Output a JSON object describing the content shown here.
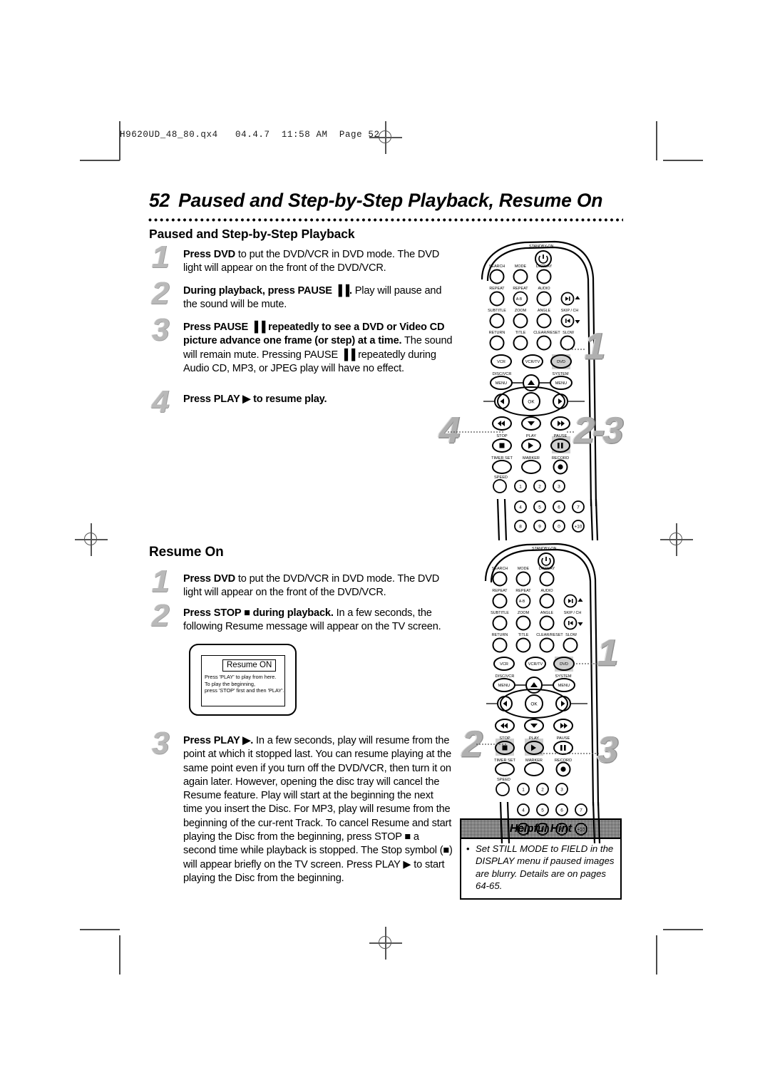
{
  "printer_slug": "H9620UD_48_80.qx4   04.4.7  11:58 AM  Page 52",
  "header": {
    "page_number": "52",
    "title": "Paused and Step-by-Step Playback, Resume On"
  },
  "sections": [
    {
      "heading": "Paused and Step-by-Step Playback",
      "steps": [
        {
          "number": "1",
          "lines": [
            {
              "bold": "Press DVD",
              "rest": " to put the DVD/VCR in DVD mode. The DVD light will appear on the front of the DVD/VCR."
            }
          ]
        },
        {
          "number": "2",
          "lines": [
            {
              "bold": "During playback, press PAUSE ▐▐.",
              "rest": " Play will pause and the sound will be mute."
            }
          ]
        },
        {
          "number": "3",
          "lines": [
            {
              "bold": "Press PAUSE ▐▐ repeatedly to see a DVD or Video CD picture advance one frame (or step) at a time.",
              "rest": " The sound will remain mute."
            },
            {
              "bold": "",
              "rest": "Pressing PAUSE ▐▐ repeatedly during Audio CD, MP3, or JPEG play will have no effect."
            }
          ]
        },
        {
          "number": "4",
          "lines": [
            {
              "bold": "Press PLAY ▶ to resume play.",
              "rest": ""
            }
          ]
        }
      ]
    },
    {
      "heading": "Resume On",
      "steps": [
        {
          "number": "1",
          "lines": [
            {
              "bold": "Press DVD",
              "rest": " to put the DVD/VCR in DVD mode. The DVD light will appear on the front of the DVD/VCR."
            }
          ]
        },
        {
          "number": "2",
          "lines": [
            {
              "bold": "Press STOP ■ during playback.",
              "rest": " In a few seconds, the following Resume message will appear on the TV screen."
            }
          ]
        },
        {
          "number": "3",
          "lines": [
            {
              "bold": "Press PLAY ▶.",
              "rest": " In a few seconds, play will resume from the point at which it stopped last. You can resume playing at the same point even if you turn off the DVD/VCR, then turn it on again later. However, opening the disc tray will cancel the Resume feature. Play will start at the beginning the next time you insert the Disc."
            },
            {
              "bold": "",
              "rest": "For MP3, play will resume from the beginning of the cur-rent Track."
            },
            {
              "bold": "",
              "rest": "To cancel Resume and start playing the Disc from the beginning, press STOP ■ a second time while playback is stopped. The Stop symbol (■) will appear briefly on the TV screen. Press PLAY ▶ to start playing the Disc from the beginning."
            }
          ]
        }
      ]
    }
  ],
  "tv_screen": {
    "title": "Resume ON",
    "line1": "Press 'PLAY' to play from here.",
    "line2": "To play the beginning,",
    "line3": "press 'STOP' first and then 'PLAY'."
  },
  "helpful_hint": {
    "heading": "Helpful Hint",
    "bullet": "•",
    "text": "Set STILL MODE to FIELD in the DISPLAY menu if paused images are blurry. Details are on pages 64-65."
  },
  "remote": {
    "standby_label": "STANDBY-ON",
    "row_labels_1": [
      "SEARCH",
      "MODE",
      "DISPLAY"
    ],
    "row_labels_2": [
      "REPEAT",
      "REPEAT",
      "AUDIO"
    ],
    "row_labels_3": [
      "SUBTITLE",
      "ZOOM",
      "ANGLE"
    ],
    "row_labels_4": [
      "RETURN",
      "TITLE",
      "CLEAR/RESET",
      "SLOW"
    ],
    "skip_label": "SKIP / CH",
    "ab_label": "A-B",
    "source_buttons": [
      "VCR",
      "VCR/TV",
      "DVD"
    ],
    "menu_labels": [
      "DISC/VCR",
      "SYSTEM"
    ],
    "menu_button": "MENU",
    "ok_button": "OK",
    "transport_labels": [
      "STOP",
      "PLAY",
      "PAUSE"
    ],
    "lower_labels": [
      "TIMER SET",
      "MARKER",
      "RECORD"
    ],
    "speed_label": "SPEED",
    "numbers": [
      "1",
      "2",
      "3",
      "4",
      "5",
      "6",
      "7",
      "8",
      "9",
      "0",
      "+10"
    ]
  },
  "callouts": {
    "remote_top": [
      "1",
      "2-3",
      "4"
    ],
    "remote_bottom": [
      "1",
      "2",
      "3"
    ]
  }
}
